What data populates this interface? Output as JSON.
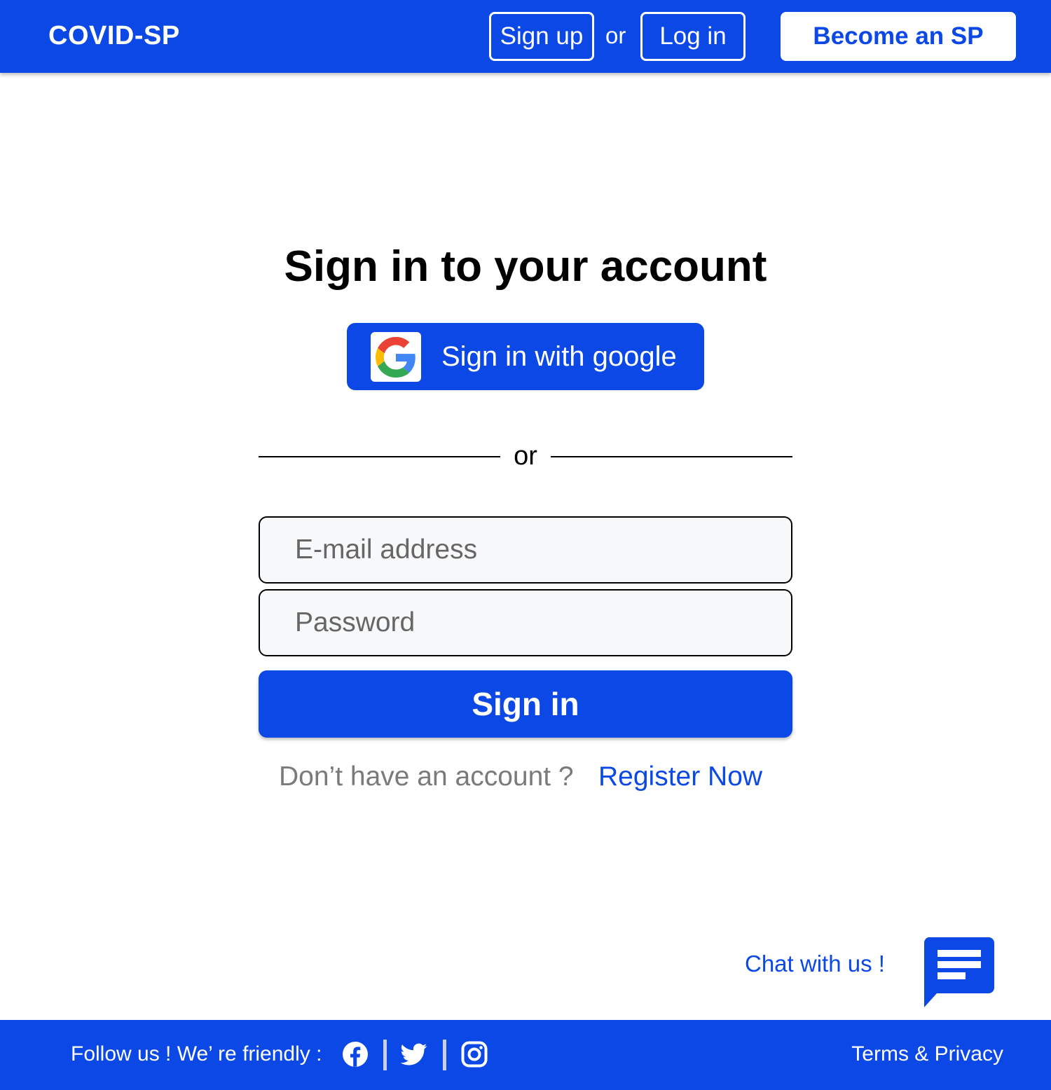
{
  "header": {
    "brand": "COVID-SP",
    "signup_label": "Sign up",
    "or_label": "or",
    "login_label": "Log in",
    "become_sp_label": "Become an SP"
  },
  "main": {
    "title": "Sign in to your account",
    "google_button_label": "Sign in with google",
    "divider_label": "or",
    "email_placeholder": "E-mail address",
    "password_placeholder": "Password",
    "signin_button_label": "Sign in",
    "no_account_text": "Don’t have an account ?",
    "register_link_label": "Register Now"
  },
  "chat": {
    "label": "Chat with us !",
    "icon": "chat-bubble-icon"
  },
  "footer": {
    "follow_text": "Follow us !  We’ re friendly :",
    "social_icons": [
      "facebook-icon",
      "twitter-icon",
      "instagram-icon"
    ],
    "terms_label": "Terms & Privacy"
  },
  "colors": {
    "brand_blue": "#0b48e6",
    "white": "#ffffff",
    "field_background": "#f7f8fa",
    "muted_text": "#7a7a7a"
  }
}
